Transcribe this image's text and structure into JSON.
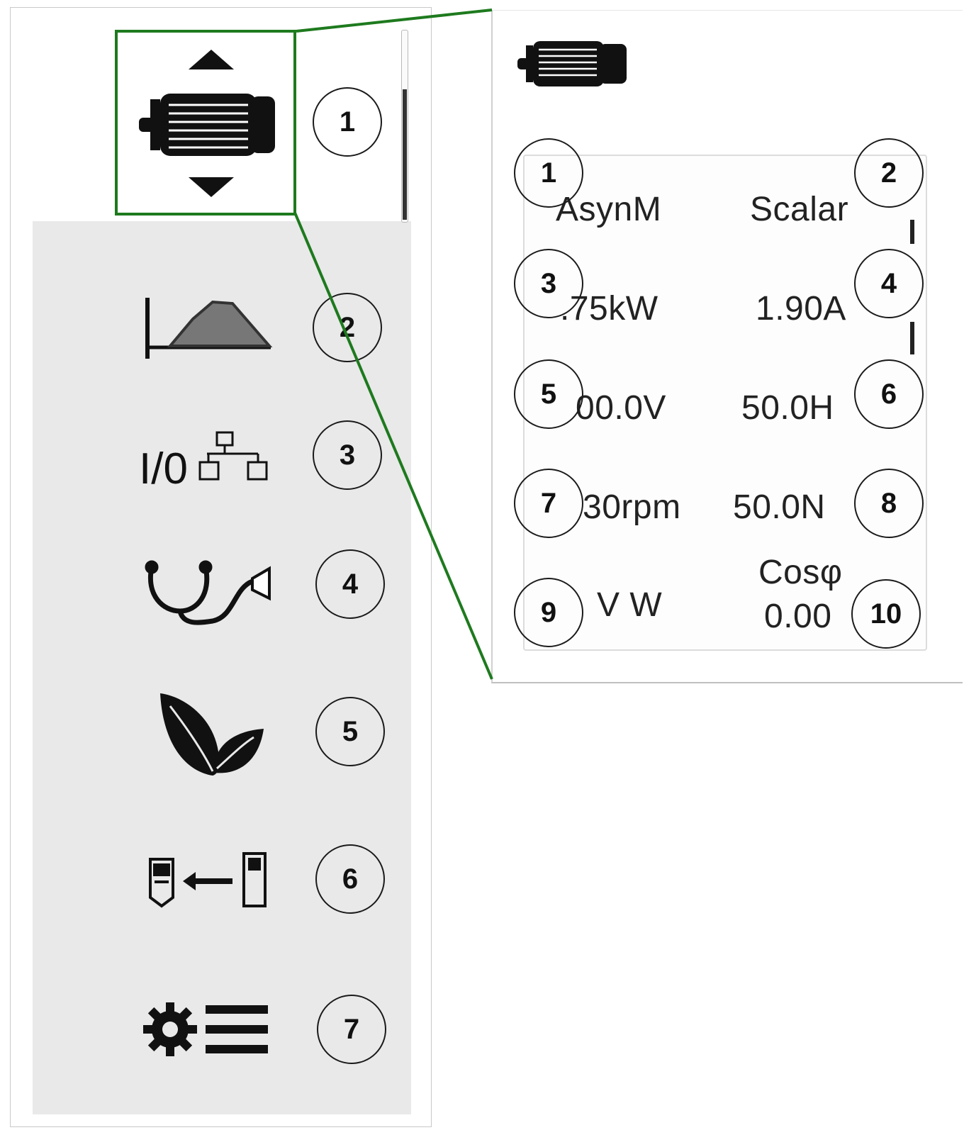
{
  "menu": {
    "items": [
      {
        "number": "1",
        "icon": "motor-icon"
      },
      {
        "number": "2",
        "icon": "ramp-profile-icon"
      },
      {
        "number": "3",
        "icon": "io-network-icon"
      },
      {
        "number": "4",
        "icon": "stethoscope-icon"
      },
      {
        "number": "5",
        "icon": "leaves-icon"
      },
      {
        "number": "6",
        "icon": "copy-keypad-icon"
      },
      {
        "number": "7",
        "icon": "gear-list-icon"
      }
    ]
  },
  "display": {
    "rows": [
      {
        "left": "AsynM",
        "right": "Scalar"
      },
      {
        "left": ".75kW",
        "right": "1.90A"
      },
      {
        "left": "00.0V",
        "right": "50.0H"
      },
      {
        "left": "30rpm",
        "right": "50.0N"
      },
      {
        "left": "V W",
        "right_top": "Cosφ",
        "right": "0.00"
      }
    ],
    "callouts": [
      "1",
      "2",
      "3",
      "4",
      "5",
      "6",
      "7",
      "8",
      "9",
      "10"
    ]
  },
  "colors": {
    "highlight": "#1e7a1e",
    "menu_bg": "#e9e9e9"
  }
}
